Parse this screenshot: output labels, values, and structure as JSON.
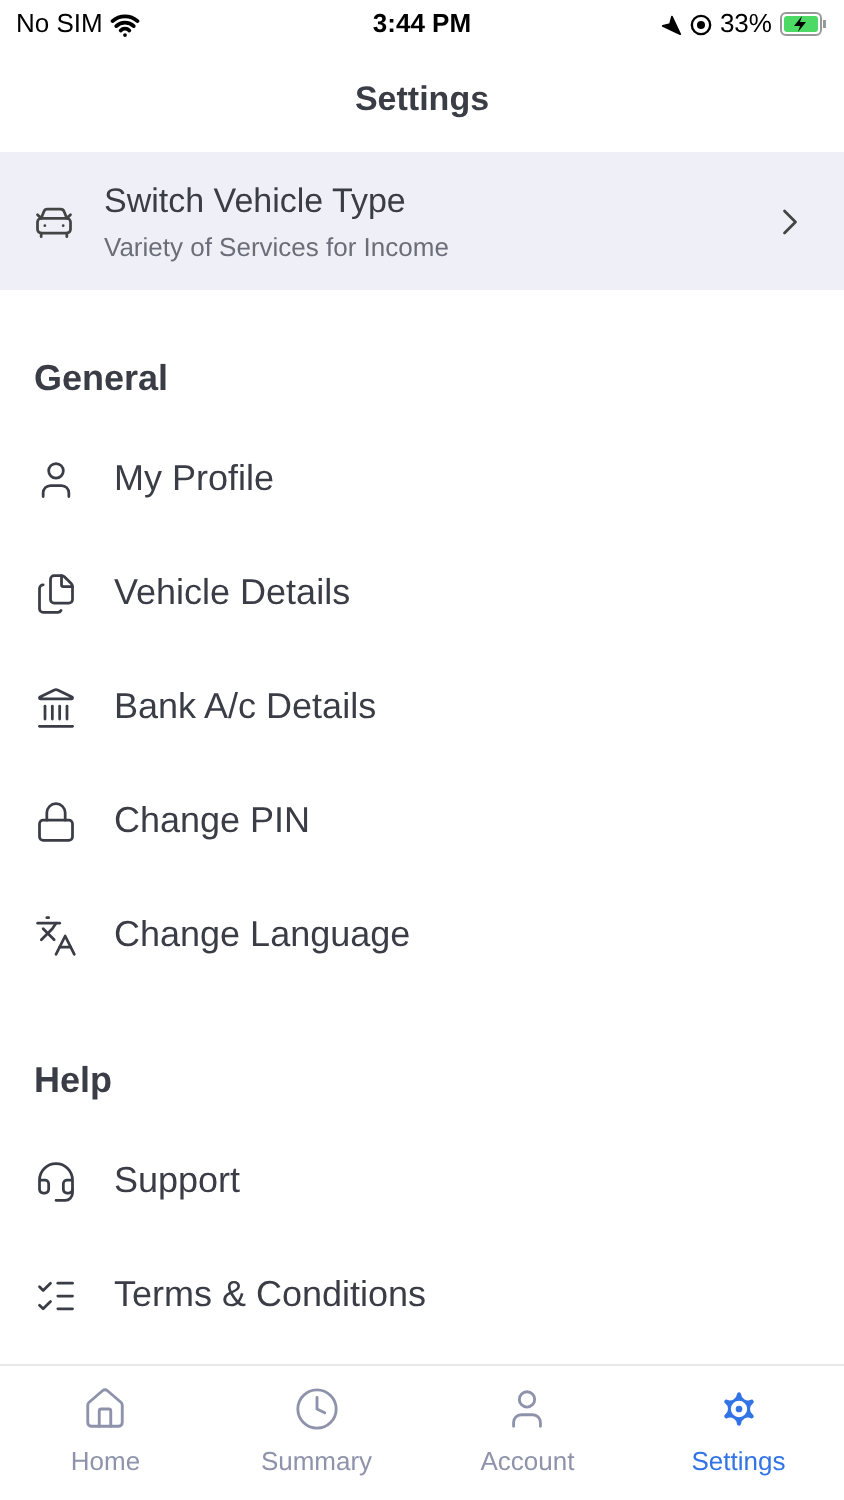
{
  "status_bar": {
    "carrier": "No SIM",
    "time": "3:44 PM",
    "battery": "33%"
  },
  "title": "Settings",
  "banner": {
    "title": "Switch Vehicle Type",
    "subtitle": "Variety of Services for Income"
  },
  "sections": [
    {
      "heading": "General",
      "items": [
        "My Profile",
        "Vehicle Details",
        "Bank A/c Details",
        "Change PIN",
        "Change Language"
      ]
    },
    {
      "heading": "Help",
      "items": [
        "Support",
        "Terms & Conditions"
      ]
    }
  ],
  "tabs": [
    {
      "label": "Home",
      "selected": false
    },
    {
      "label": "Summary",
      "selected": false
    },
    {
      "label": "Account",
      "selected": false
    },
    {
      "label": "Settings",
      "selected": true
    }
  ]
}
